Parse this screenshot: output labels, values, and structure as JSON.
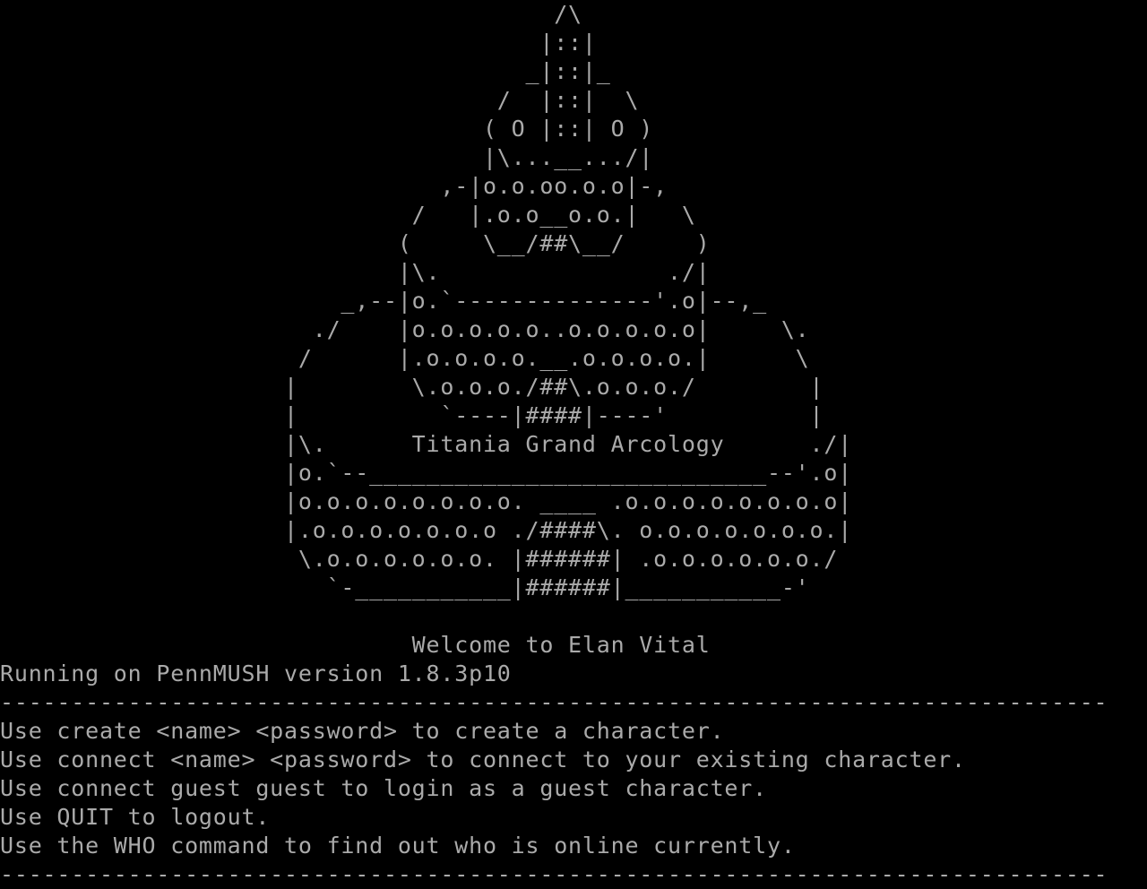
{
  "terminal": {
    "colors": {
      "background": "#000000",
      "foreground": "#aaaaaa"
    },
    "art_lines": [
      "                                       /\\",
      "                                      |::|",
      "                                     _|::|_",
      "                                   /  |::|  \\",
      "                                  ( O |::| O )",
      "                                  |\\...__.../|",
      "                               ,-|o.o.oo.o.o|-,",
      "                             /   |.o.o__o.o.|   \\",
      "                            (     \\__/##\\__/     )",
      "                            |\\.                ./|",
      "                        _,--|o.`--------------'.o|--,_",
      "                      ./    |o.o.o.o.o..o.o.o.o.o|     \\.",
      "                     /      |.o.o.o.o.__.o.o.o.o.|      \\",
      "                    |        \\.o.o.o./##\\.o.o.o./        |",
      "                    |          `----|####|----'          |",
      "                    |\\.      Titania Grand Arcology      ./|",
      "                    |o.`--____________________________--'.o|",
      "                    |o.o.o.o.o.o.o.o. ____ .o.o.o.o.o.o.o.o|",
      "                    |.o.o.o.o.o.o.o ./####\\. o.o.o.o.o.o.o.|",
      "                     \\.o.o.o.o.o.o. |######| .o.o.o.o.o.o./",
      "                       `-___________|######|___________-'",
      "",
      "                             Welcome to Elan Vital"
    ],
    "running_line": "Running on PennMUSH version 1.8.3p10",
    "divider": "------------------------------------------------------------------------------",
    "help_lines": [
      "Use create <name> <password> to create a character.",
      "Use connect <name> <password> to connect to your existing character.",
      "Use connect guest guest to login as a guest character.",
      "Use QUIT to logout.",
      "Use the WHO command to find out who is online currently."
    ]
  }
}
